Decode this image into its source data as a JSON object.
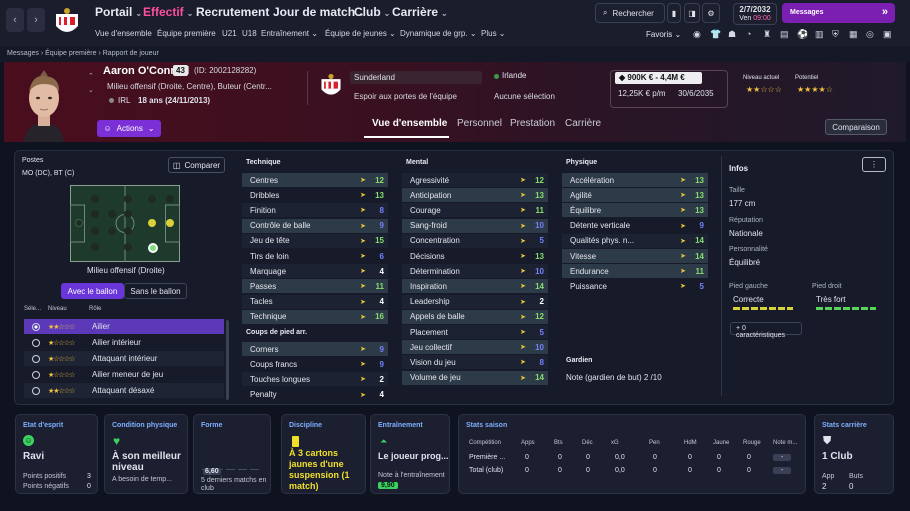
{
  "nav": {
    "menus": [
      "Portail",
      "Effectif",
      "Recrutement",
      "Jour de match",
      "Club",
      "Carrière"
    ],
    "submenus": [
      "Vue d'ensemble",
      "Équipe première",
      "U21",
      "U18",
      "Entraînement",
      "Équipe de jeunes",
      "Dynamique de grp.",
      "Plus"
    ],
    "search": "Rechercher",
    "date": "2/7/2032",
    "day_time": "Ven",
    "time": "09:00",
    "messages": "Messages",
    "favoris": "Favoris"
  },
  "breadcrumb": [
    "Messages",
    "Équipe première",
    "Rapport de joueur"
  ],
  "player": {
    "name": "Aaron O'Connell",
    "number": "43",
    "id": "(ID: 2002128282)",
    "positions": "Milieu offensif (Droite, Centre), Buteur (Centr...",
    "nationality": "IRL",
    "age": "18 ans (24/11/2013)",
    "club": "Sunderland",
    "club_status": "Espoir aux portes de l'équipe",
    "nation": "Irlande",
    "selection": "Aucune sélection",
    "value": "900K € - 4,4M €",
    "wage": "12,25K € p/m",
    "contract": "30/6/2035",
    "current_level_label": "Niveau actuel",
    "potential_label": "Potentiel",
    "current_stars": "★★☆☆☆",
    "potential_stars": "★★★★☆"
  },
  "actions": "Actions",
  "tabs": [
    "Vue d'ensemble",
    "Personnel",
    "Prestation",
    "Carrière"
  ],
  "compare": "Comparaison",
  "left": {
    "postes": "Postes",
    "postes_val": "MO (DC), BT (C)",
    "compare": "Comparer",
    "pitch_caption": "Milieu offensif (Droite)",
    "with_ball": "Avec le ballon",
    "without_ball": "Sans le ballon",
    "cols": [
      "Séle...",
      "Niveau",
      "Rôle"
    ],
    "roles": [
      {
        "label": "Ailier",
        "stars": "★★☆☆☆",
        "sel": true
      },
      {
        "label": "Ailier intérieur",
        "stars": "★☆☆☆☆"
      },
      {
        "label": "Attaquant intérieur",
        "stars": "★☆☆☆☆"
      },
      {
        "label": "Ailier meneur de jeu",
        "stars": "★☆☆☆☆"
      },
      {
        "label": "Attaquant désaxé",
        "stars": "★★☆☆☆"
      }
    ]
  },
  "technique": {
    "title": "Technique",
    "attrs": [
      [
        "Centres",
        "12"
      ],
      [
        "Dribbles",
        "13"
      ],
      [
        "Finition",
        "8"
      ],
      [
        "Contrôle de balle",
        "9"
      ],
      [
        "Jeu de tête",
        "15"
      ],
      [
        "Tirs de loin",
        "6"
      ],
      [
        "Marquage",
        "4"
      ],
      [
        "Passes",
        "11"
      ],
      [
        "Tacles",
        "4"
      ],
      [
        "Technique",
        "16"
      ]
    ]
  },
  "set_pieces": {
    "title": "Coups de pied arr.",
    "attrs": [
      [
        "Corners",
        "9"
      ],
      [
        "Coups francs",
        "9"
      ],
      [
        "Touches longues",
        "2"
      ],
      [
        "Penalty",
        "4"
      ]
    ]
  },
  "mental": {
    "title": "Mental",
    "attrs": [
      [
        "Agressivité",
        "12"
      ],
      [
        "Anticipation",
        "13"
      ],
      [
        "Courage",
        "11"
      ],
      [
        "Sang-froid",
        "10"
      ],
      [
        "Concentration",
        "5"
      ],
      [
        "Décisions",
        "13"
      ],
      [
        "Détermination",
        "10"
      ],
      [
        "Inspiration",
        "14"
      ],
      [
        "Leadership",
        "2"
      ],
      [
        "Appels de balle",
        "12"
      ],
      [
        "Placement",
        "5"
      ],
      [
        "Jeu collectif",
        "10"
      ],
      [
        "Vision du jeu",
        "8"
      ],
      [
        "Volume de jeu",
        "14"
      ]
    ]
  },
  "physique": {
    "title": "Physique",
    "attrs": [
      [
        "Accélération",
        "13"
      ],
      [
        "Agilité",
        "13"
      ],
      [
        "Équilibre",
        "13"
      ],
      [
        "Détente verticale",
        "9"
      ],
      [
        "Qualités phys. n...",
        "14"
      ],
      [
        "Vitesse",
        "14"
      ],
      [
        "Endurance",
        "11"
      ],
      [
        "Puissance",
        "5"
      ]
    ]
  },
  "gardien": {
    "title": "Gardien",
    "label": "Note (gardien de but)",
    "value": "2 /10"
  },
  "infos": {
    "title": "Infos",
    "taille_l": "Taille",
    "taille": "177 cm",
    "rep_l": "Réputation",
    "rep": "Nationale",
    "pers_l": "Personnalité",
    "pers": "Équilibré",
    "pg_l": "Pied gauche",
    "pg": "Correcte",
    "pd_l": "Pied droit",
    "pd": "Très fort",
    "traits": "0 caractéristiques"
  },
  "cards": {
    "esprit": {
      "t": "Etat d'esprit",
      "v": "Ravi",
      "l1": "Points positifs",
      "v1": "3",
      "l2": "Points négatifs",
      "v2": "0"
    },
    "condition": {
      "t": "Condition physique",
      "v": "À son meilleur niveau",
      "s": "A besoin de temp..."
    },
    "forme": {
      "t": "Forme",
      "v": "6,60",
      "s": "5 derniers matchs en club"
    },
    "discipline": {
      "t": "Discipline",
      "v": "À 3 cartons jaunes d'une suspension (1 match)"
    },
    "entrainement": {
      "t": "Entraînement",
      "v": "Le joueur prog...",
      "s": "Note à l'entraînement",
      "n": "9,90"
    },
    "stats": {
      "t": "Stats saison",
      "cols": [
        "Compétition",
        "Apps",
        "Bts",
        "Déc",
        "xG",
        "Pen",
        "HdM",
        "Jaune",
        "Rouge",
        "Note m..."
      ],
      "rows": [
        [
          "Première ...",
          "0",
          "0",
          "0",
          "0,0",
          "0",
          "0",
          "0",
          "0",
          "-"
        ],
        [
          "Total (club)",
          "0",
          "0",
          "0",
          "0,0",
          "0",
          "0",
          "0",
          "0",
          "-"
        ]
      ]
    },
    "carriere": {
      "t": "Stats carrière",
      "v": "1 Club",
      "l1": "App",
      "v1": "2",
      "l2": "Buts",
      "v2": "0"
    }
  }
}
